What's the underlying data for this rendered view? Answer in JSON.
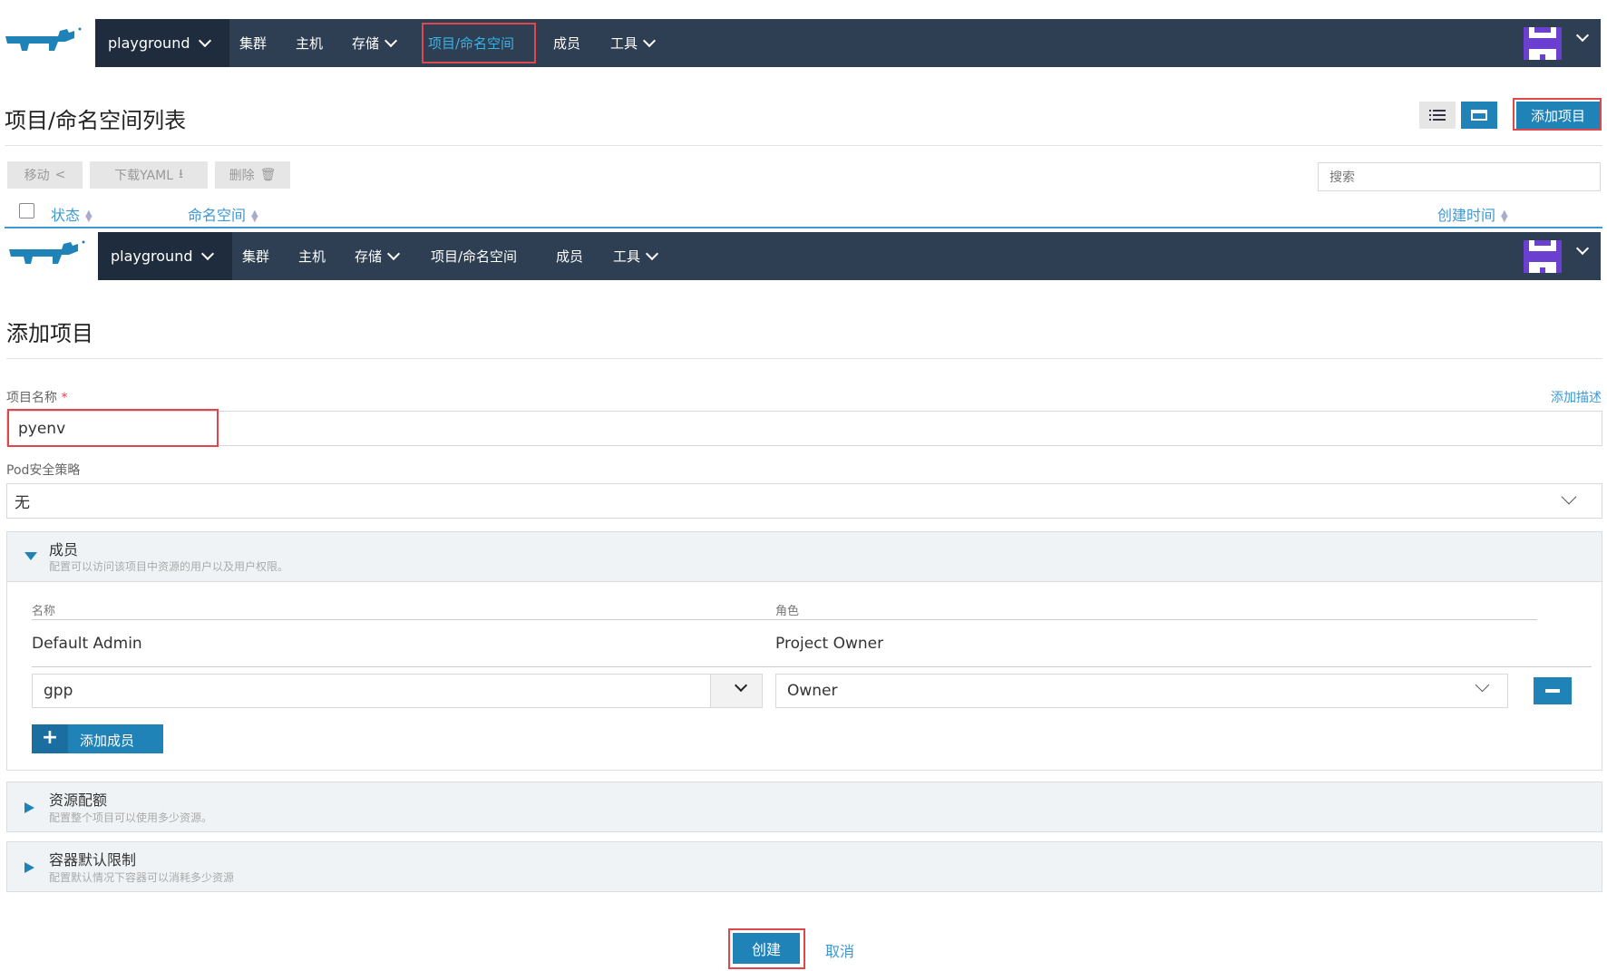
{
  "nav": {
    "cluster": "playground",
    "items": [
      "集群",
      "主机",
      "存储",
      "项目/命名空间",
      "成员",
      "工具"
    ],
    "active": "项目/命名空间"
  },
  "list_page": {
    "title": "项目/命名空间列表",
    "add_project": "添加项目",
    "bulk": {
      "move": "移动",
      "download": "下载YAML",
      "delete": "删除"
    },
    "search_placeholder": "搜索",
    "columns": {
      "state": "状态",
      "namespace": "命名空间",
      "created": "创建时间"
    }
  },
  "form": {
    "title": "添加项目",
    "name_label": "项目名称",
    "required_mark": "*",
    "add_description": "添加描述",
    "name_value": "pyenv",
    "pod_policy_label": "Pod安全策略",
    "pod_policy_value": "无",
    "members": {
      "title": "成员",
      "subtitle": "配置可以访问该项目中资源的用户以及用户权限。",
      "col_name": "名称",
      "col_role": "角色",
      "default_name": "Default Admin",
      "default_role": "Project Owner",
      "new_user_value": "gpp",
      "new_role_value": "Owner",
      "add_member": "添加成员"
    },
    "quota": {
      "title": "资源配额",
      "subtitle": "配置整个项目可以使用多少资源。"
    },
    "limits": {
      "title": "容器默认限制",
      "subtitle": "配置默认情况下容器可以消耗多少资源"
    },
    "create": "创建",
    "cancel": "取消"
  },
  "colors": {
    "nav_bg": "#2e3e53",
    "primary": "#1f83b8",
    "highlight": "#e0474c",
    "link": "#3d98d3"
  }
}
